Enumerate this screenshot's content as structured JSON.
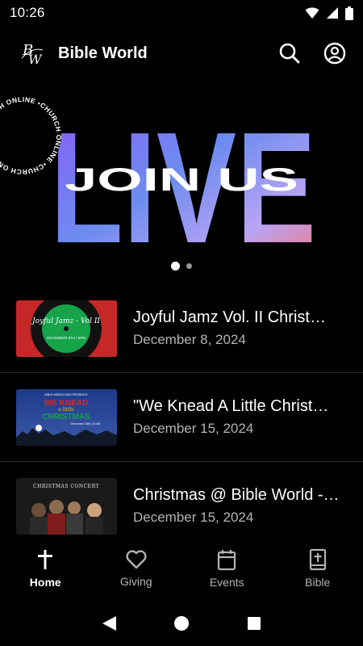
{
  "status_bar": {
    "time": "10:26"
  },
  "app_bar": {
    "title": "Bible World",
    "logo_initials": "BW"
  },
  "banner": {
    "headline": "LIVE",
    "subheadline": "JOIN US",
    "badge_text": "•CHURCH ONLINE •CHURCH ONLINE •CHURCH ONLINE ",
    "dots": {
      "count": 2,
      "active_index": 0
    }
  },
  "events": [
    {
      "title": "Joyful Jamz Vol. II Christ…",
      "date": "December 8, 2024",
      "thumb_text": "Joyful Jamz - Vol II",
      "thumb_sub": "DECEMBER 8TH | 6PM"
    },
    {
      "title": "\"We Knead A Little Christ…",
      "date": "December 15, 2024",
      "thumb_text": "WE KNEAD",
      "thumb_sub": "CHRISTMAS",
      "thumb_top": "BIBLE WORLD KIDS PRESENTS",
      "thumb_mid": "a little",
      "thumb_foot": "December 15th | 10 AM"
    },
    {
      "title": "Christmas @ Bible World -…",
      "date": "December 15, 2024",
      "thumb_text": "CHRISTMAS CONCERT"
    }
  ],
  "bottom_nav": {
    "items": [
      {
        "label": "Home",
        "icon": "cross-icon",
        "active": true
      },
      {
        "label": "Giving",
        "icon": "heart-icon",
        "active": false
      },
      {
        "label": "Events",
        "icon": "calendar-icon",
        "active": false
      },
      {
        "label": "Bible",
        "icon": "bible-icon",
        "active": false
      }
    ]
  },
  "colors": {
    "background": "#000000",
    "gradient_start": "#8a5cf6",
    "gradient_end": "#f87171"
  }
}
